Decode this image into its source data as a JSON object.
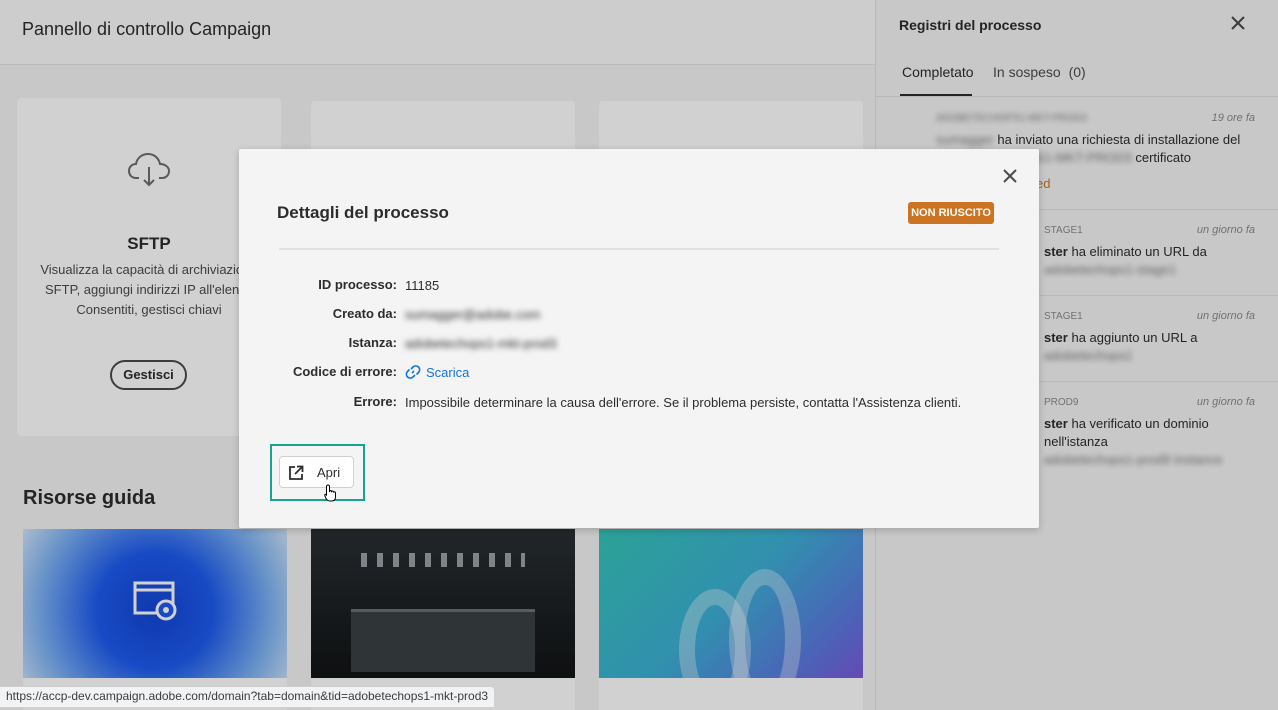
{
  "page": {
    "title": "Pannello di controllo Campaign",
    "cards": [
      {
        "title": "SFTP",
        "description": "Visualizza la capacità di archiviazione\nSFTP, aggiungi indirizzi IP all'elenco\nConsentiti, gestisci chiavi",
        "button_label": "Gestisci",
        "icon": "cloud-download-icon"
      }
    ],
    "section_title": "Risorse guida"
  },
  "panel": {
    "title": "Registri del processo",
    "tabs": [
      {
        "label": "Completato",
        "active": true
      },
      {
        "label": "In sospeso",
        "count": "(0)",
        "active": false
      }
    ],
    "items": [
      {
        "time": "19 ore fa",
        "meta": "ADOBETECHOPS1-MKT-PROD3",
        "actor": "sumagger",
        "text": " ha inviato una richiesta di installazione del",
        "line2_blur": "ADOBETECHOPS1-MKT-PROD3",
        "line2": " certificato sull'istanza",
        "status": "ed"
      },
      {
        "time": "un giorno fa",
        "meta": "STAGE1",
        "actor": "ster",
        "text": " ha eliminato un URL da",
        "line2_blur": "adobetechops1-stage1"
      },
      {
        "time": "un giorno fa",
        "meta": "STAGE1",
        "actor": "ster",
        "text": " ha aggiunto un URL a ",
        "line2_blur": "adobetechops1"
      },
      {
        "time": "un giorno fa",
        "meta": "PROD9",
        "actor": "ster",
        "text": " ha verificato un dominio nell'istanza",
        "line2_blur": "adobetechops1-prod9 instance"
      }
    ]
  },
  "dialog": {
    "title": "Dettagli del processo",
    "status": "NON RIUSCITO",
    "status_color": "#cb7424",
    "fields": [
      {
        "label": "ID processo:",
        "value": "11185"
      },
      {
        "label": "Creato da:",
        "value": "sumagger@adobe.com",
        "blurred": true
      },
      {
        "label": "Istanza:",
        "value": "adobetechops1-mkt-prod3",
        "blurred": true
      },
      {
        "label": "Codice di errore:",
        "value": "Scarica",
        "link": true
      },
      {
        "label": "Errore:",
        "value": "Impossibile determinare la causa dell'errore. Se il problema persiste, contatta l'Assistenza clienti."
      }
    ],
    "open_button_label": "Apri"
  },
  "status_url": "https://accp-dev.campaign.adobe.com/domain?tab=domain&tid=adobetechops1-mkt-prod3",
  "colors": {
    "accent": "#1473e6",
    "focus": "#15a58f",
    "badge": "#cb7424"
  }
}
